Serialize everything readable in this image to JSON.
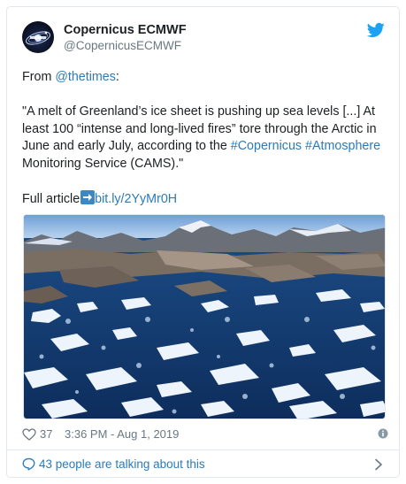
{
  "author": {
    "name": "Copernicus ECMWF",
    "handle": "@CopernicusECMWF",
    "avatar_icon": "copernicus-logo",
    "platform_icon": "twitter-bird-icon"
  },
  "tweet": {
    "from_prefix": "From ",
    "from_mention": "@thetimes",
    "from_suffix": ":",
    "quote_part1": "\"A melt of Greenland’s ice sheet is pushing up sea levels [...] At least 100 “intense and long-lived fires” tore through the Arctic in June and early July, according to the ",
    "hashtag1": "#Copernicus",
    "space": " ",
    "hashtag2": "#Atmosphere",
    "quote_part2": " Monitoring Service (CAMS).\"",
    "full_article_label": "Full article",
    "arrow_icon": "right-arrow-emoji-icon",
    "link": "bit.ly/2YyMr0H"
  },
  "meta": {
    "likes": "37",
    "timestamp": "3:36 PM - Aug 1, 2019",
    "heart_icon": "heart-icon",
    "info_icon": "info-icon"
  },
  "footer": {
    "talking": "43 people are talking about this",
    "bubble_icon": "speech-bubble-icon",
    "chevron_icon": "chevron-right-icon"
  },
  "colors": {
    "link": "#2b7bb9",
    "secondary": "#697882",
    "border": "#e1e8ed",
    "twitter_blue": "#1da1f2"
  }
}
